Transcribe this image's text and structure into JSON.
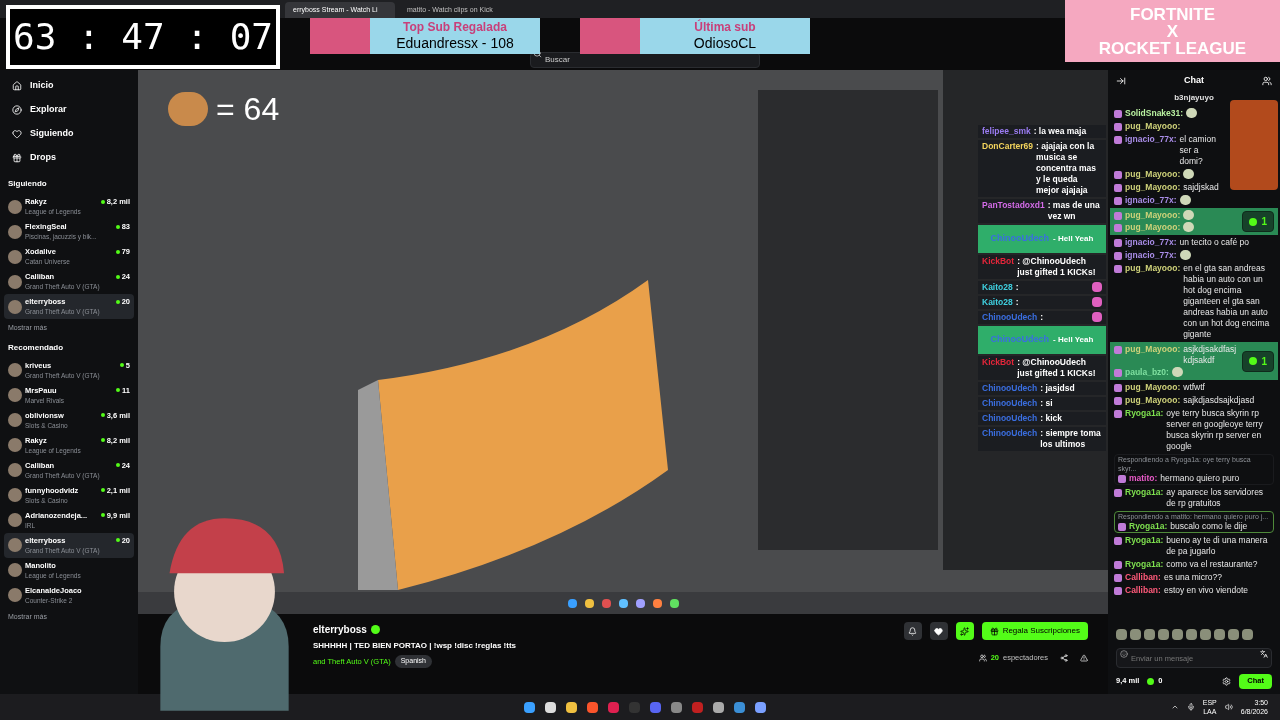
{
  "browser_tabs": [
    {
      "label": "erryboss Stream - Watch Li",
      "selected": true
    },
    {
      "label": "matito - Watch clips on Kick",
      "selected": false
    }
  ],
  "timer": {
    "text": "63 : 47 : 07"
  },
  "banners": [
    {
      "title": "Top Sub Regalada",
      "value": "Eduandressx - 108"
    },
    {
      "title": "Última sub",
      "value": "OdiosoCL"
    }
  ],
  "event_logo": {
    "lines": [
      "FORTNITE",
      "X",
      "ROCKET LEAGUE"
    ]
  },
  "search": {
    "placeholder": "Buscar"
  },
  "sidebar": {
    "nav": [
      "Inicio",
      "Explorar",
      "Siguiendo",
      "Drops"
    ],
    "sections": [
      {
        "title": "Siguiendo",
        "more": "Mostrar más",
        "channels": [
          {
            "name": "Rakyz",
            "category": "League of Legends",
            "viewers": "8,2 mil",
            "selected": false
          },
          {
            "name": "FlexingSeal",
            "category": "Piscinas, jacuzzis y bik...",
            "viewers": "83",
            "selected": false
          },
          {
            "name": "Xodalive",
            "category": "Catan Universe",
            "viewers": "79",
            "selected": false
          },
          {
            "name": "Calliban",
            "category": "Grand Theft Auto V (GTA)",
            "viewers": "24",
            "selected": false
          },
          {
            "name": "elterryboss",
            "category": "Grand Theft Auto V (GTA)",
            "viewers": "20",
            "selected": true
          }
        ]
      },
      {
        "title": "Recomendado",
        "more": "Mostrar más",
        "channels": [
          {
            "name": "kriveus",
            "category": "Grand Theft Auto V (GTA)",
            "viewers": "5",
            "selected": false
          },
          {
            "name": "MrsPauu",
            "category": "Marvel Rivals",
            "viewers": "11",
            "selected": false
          },
          {
            "name": "oblivionsw",
            "category": "Slots & Casino",
            "viewers": "3,6 mil",
            "selected": false
          },
          {
            "name": "Rakyz",
            "category": "League of Legends",
            "viewers": "8,2 mil",
            "selected": false
          },
          {
            "name": "Calliban",
            "category": "Grand Theft Auto V (GTA)",
            "viewers": "24",
            "selected": false
          },
          {
            "name": "funnyhoodvidz",
            "category": "Slots & Casino",
            "viewers": "2,1 mil",
            "selected": false
          },
          {
            "name": "Adrianozendeja...",
            "category": "IRL",
            "viewers": "9,9 mil",
            "selected": false
          },
          {
            "name": "elterryboss",
            "category": "Grand Theft Auto V (GTA)",
            "viewers": "20",
            "selected": true
          },
          {
            "name": "Manolito",
            "category": "League of Legends",
            "selected": false
          },
          {
            "name": "ElcanaldeJoaco",
            "category": "Counter-Strike 2",
            "selected": false
          }
        ]
      }
    ]
  },
  "stream": {
    "counter": "= 64",
    "overlay_chat": [
      {
        "kind": "message",
        "user": "felipee_smk",
        "color": "#9b7cf2",
        "text": ": la wea maja",
        "emote": false
      },
      {
        "kind": "message",
        "user": "DonCarter69",
        "color": "#f2d35c",
        "text": ": ajajaja con la musica se concentra mas y le queda mejor ajajaja",
        "emote": false
      },
      {
        "kind": "message",
        "user": "PanTostadoxd1",
        "color": "#d46be8",
        "text": ": mas de una vez wn",
        "emote": false
      },
      {
        "kind": "alert",
        "user": "ChinooUdech",
        "color": "#3a6ee0",
        "text": "- Hell Yeah"
      },
      {
        "kind": "message",
        "user": "KickBot",
        "color": "#e3263a",
        "text": ": @ChinooUdech just gifted 1 KICKs!",
        "emote": false
      },
      {
        "kind": "message",
        "user": "Kaito28",
        "color": "#3fd0e0",
        "text": ":",
        "emote": true
      },
      {
        "kind": "message",
        "user": "Kaito28",
        "color": "#3fd0e0",
        "text": ":",
        "emote": true
      },
      {
        "kind": "message",
        "user": "ChinooUdech",
        "color": "#3a6ee0",
        "text": ":",
        "emote": true
      },
      {
        "kind": "alert",
        "user": "ChinooUdech",
        "color": "#3a6ee0",
        "text": "- Hell Yeah"
      },
      {
        "kind": "message",
        "user": "KickBot",
        "color": "#e3263a",
        "text": ": @ChinooUdech just gifted 1 KICKs!",
        "emote": false
      },
      {
        "kind": "message",
        "user": "ChinooUdech",
        "color": "#3a6ee0",
        "text": ": jasjdsd",
        "emote": false
      },
      {
        "kind": "message",
        "user": "ChinooUdech",
        "color": "#3a6ee0",
        "text": ": si",
        "emote": false
      },
      {
        "kind": "message",
        "user": "ChinooUdech",
        "color": "#3a6ee0",
        "text": ": kick",
        "emote": false
      },
      {
        "kind": "message",
        "user": "ChinooUdech",
        "color": "#3a6ee0",
        "text": ": siempre toma los ultimos",
        "emote": false
      }
    ]
  },
  "streamer": {
    "name": "elterryboss",
    "verified": true,
    "title": "SHHHHH | TED BIEN PORTAO | !wsp !disc !reglas !tts",
    "category": "and Theft Auto V (GTA)",
    "tag": "Spanish",
    "viewers": "20",
    "viewers_label": "espectadores",
    "subscribe_button": "Regala Suscripciones"
  },
  "chat": {
    "title": "Chat",
    "pinned": "b3njayuyo",
    "input": {
      "placeholder": "Enviar un mensaje"
    },
    "followers": "9,4 mil",
    "kicks": "0",
    "send_button": "Chat",
    "messages": [
      {
        "kind": "message",
        "user": "SolidSnake31:",
        "color": "#b8f0a0",
        "emote": true
      },
      {
        "kind": "message",
        "user": "pug_Mayooo:",
        "color": "#cfd27a",
        "emote": false
      },
      {
        "kind": "message",
        "user": "ignacio_77x:",
        "color": "#a98de8",
        "text": "el camion ser a domi?",
        "emote": false
      },
      {
        "kind": "message",
        "user": "pug_Mayooo:",
        "color": "#cfd27a",
        "emote": true
      },
      {
        "kind": "message",
        "user": "pug_Mayooo:",
        "color": "#cfd27a",
        "text": "sajdjskad",
        "emote": false
      },
      {
        "kind": "message",
        "user": "ignacio_77x:",
        "color": "#a98de8",
        "emote": true
      },
      {
        "kind": "gift",
        "count": "1",
        "messages": [
          {
            "user": "pug_Mayooo:",
            "color": "#cfd27a",
            "emote": true
          },
          {
            "user": "pug_Mayooo:",
            "color": "#cfd27a",
            "emote": true
          }
        ]
      },
      {
        "kind": "message",
        "user": "ignacio_77x:",
        "color": "#a98de8",
        "text": "un tecito o café po",
        "emote": false
      },
      {
        "kind": "message",
        "user": "ignacio_77x:",
        "color": "#a98de8",
        "emote": true
      },
      {
        "kind": "message",
        "user": "pug_Mayooo:",
        "color": "#cfd27a",
        "text": "en el gta san andreas habia un auto con un hot dog encima giganteen el gta san andreas habia un auto con un hot dog encima gigante",
        "emote": false
      },
      {
        "kind": "gift",
        "count": "1",
        "messages": [
          {
            "user": "pug_Mayooo:",
            "color": "#cfd27a",
            "text": "asjkdjsakdfasjkdjsakdf",
            "emote": false
          },
          {
            "user": "paula_bz0:",
            "color": "#7ee0a0",
            "emote": true
          }
        ]
      },
      {
        "kind": "message",
        "user": "pug_Mayooo:",
        "color": "#cfd27a",
        "text": "wtfwtf",
        "emote": false
      },
      {
        "kind": "message",
        "user": "pug_Mayooo:",
        "color": "#cfd27a",
        "text": "sajkdjasdsajkdjasd",
        "emote": false
      },
      {
        "kind": "message",
        "user": "Ryoga1a:",
        "color": "#7ee04f",
        "text": "oye terry busca skyrin rp server en googleoye terry busca skyrin rp server en google",
        "emote": false
      },
      {
        "kind": "reply",
        "reply_to": "Respondiendo a Ryoga1a: oye terry busca skyr...",
        "highlighted": false,
        "user": "matito:",
        "color": "#e85ac8",
        "text": "hermano quiero puro"
      },
      {
        "kind": "message",
        "user": "Ryoga1a:",
        "color": "#7ee04f",
        "text": "ay aparece los servidores de rp gratuitos",
        "emote": false
      },
      {
        "kind": "reply",
        "reply_to": "Respondiendo a matito: hermano quiero puro j...",
        "highlighted": true,
        "user": "Ryoga1a:",
        "color": "#7ee04f",
        "text": "buscalo como le dije"
      },
      {
        "kind": "message",
        "user": "Ryoga1a:",
        "color": "#7ee04f",
        "text": "bueno ay te di una manera de pa jugarlo",
        "emote": false
      },
      {
        "kind": "message",
        "user": "Ryoga1a:",
        "color": "#7ee04f",
        "text": "como va el restaurante?",
        "emote": false
      },
      {
        "kind": "message",
        "user": "Calliban:",
        "color": "#ff5a7a",
        "text": "es una micro??",
        "emote": false
      },
      {
        "kind": "message",
        "user": "Calliban:",
        "color": "#ff5a7a",
        "text": "estoy en vivo viendote",
        "emote": false
      }
    ]
  },
  "taskbar": {
    "language": "ESP",
    "layout": "LAA",
    "time": "3:50",
    "date": "6/8/2026"
  }
}
